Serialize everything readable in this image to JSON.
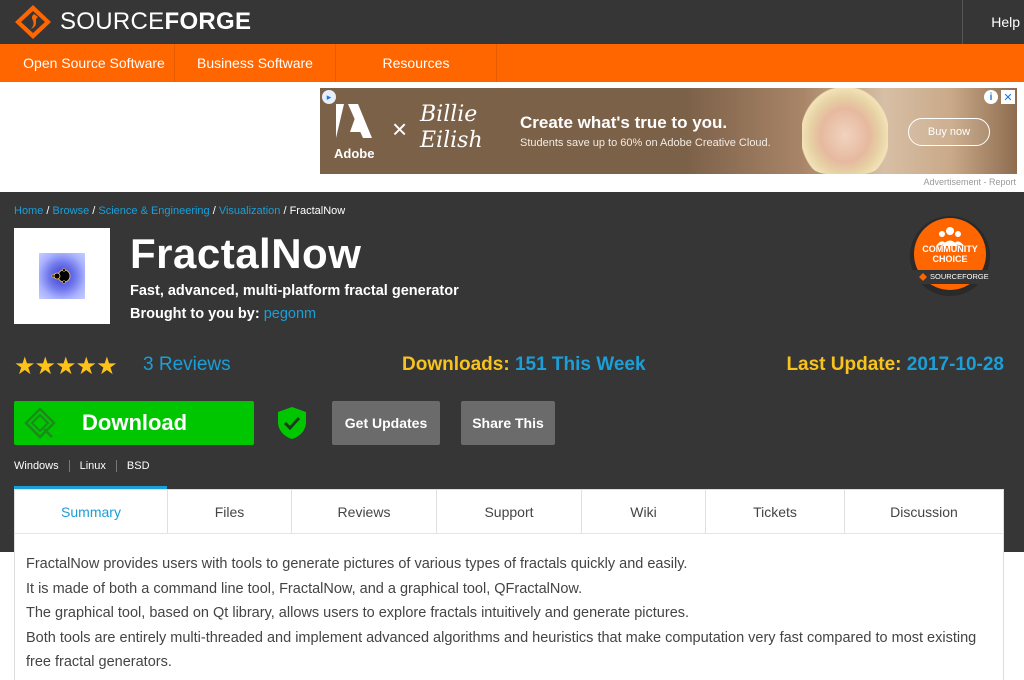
{
  "header": {
    "logo_text_light": "SOURCE",
    "logo_text_bold": "FORGE",
    "help_label": "Help"
  },
  "nav": {
    "items": [
      {
        "label": "Open Source Software"
      },
      {
        "label": "Business Software"
      },
      {
        "label": "Resources"
      }
    ]
  },
  "ad": {
    "brand": "Adobe",
    "times": "×",
    "partner_line1": "Billie",
    "partner_line2": "Eilish",
    "headline": "Create what's true to you.",
    "subline": "Students save up to 60% on Adobe Creative Cloud.",
    "cta": "Buy now",
    "caption": "Advertisement - Report"
  },
  "breadcrumb": {
    "items": [
      "Home",
      "Browse",
      "Science & Engineering",
      "Visualization"
    ],
    "current": "FractalNow"
  },
  "project": {
    "title": "FractalNow",
    "description": "Fast, advanced, multi-platform fractal generator",
    "brought_by_label": "Brought to you by:",
    "author": "pegonm",
    "badge_line1": "COMMUNITY",
    "badge_line2": "CHOICE",
    "badge_brand": "SOURCEFORGE"
  },
  "stats": {
    "stars": "★★★★★",
    "rating_fraction": 1.0,
    "reviews": "3 Reviews",
    "downloads_label": "Downloads:",
    "downloads_value": "151 This Week",
    "last_update_label": "Last Update:",
    "last_update_value": "2017-10-28"
  },
  "actions": {
    "download_label": "Download",
    "get_updates_label": "Get Updates",
    "share_label": "Share This"
  },
  "platforms": [
    "Windows",
    "Linux",
    "BSD"
  ],
  "tabs": [
    {
      "label": "Summary",
      "active": true
    },
    {
      "label": "Files"
    },
    {
      "label": "Reviews"
    },
    {
      "label": "Support"
    },
    {
      "label": "Wiki"
    },
    {
      "label": "Tickets"
    },
    {
      "label": "Discussion"
    }
  ],
  "summary": {
    "lines": [
      "FractalNow provides users with tools to generate pictures of various types of fractals quickly and easily.",
      "It is made of both a command line tool, FractalNow, and a graphical tool, QFractalNow.",
      "The graphical tool, based on Qt library, allows users to explore fractals intuitively and generate pictures.",
      "Both tools are entirely multi-threaded and implement advanced algorithms and heuristics that make computation very fast compared to most existing free fractal generators."
    ]
  },
  "colors": {
    "header_bg": "#363636",
    "nav_bg": "#ff6600",
    "link_blue": "#1a9fd8",
    "highlight_yellow": "#f9c31d",
    "download_green": "#00c600"
  }
}
